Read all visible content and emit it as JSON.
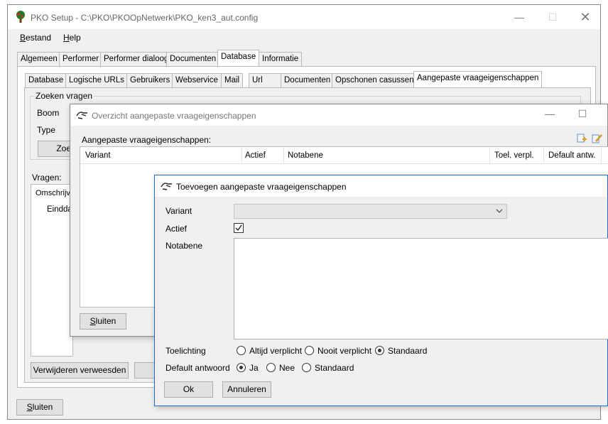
{
  "main_window": {
    "title": "PKO Setup - C:\\PKO\\PKOOpNetwerk\\PKO_ken3_aut.config",
    "menu": [
      {
        "first": "B",
        "rest": "estand"
      },
      {
        "first": "H",
        "rest": "elp"
      }
    ],
    "tabs": [
      "Algemeen",
      "Performer",
      "Performer dialoog",
      "Documenten",
      "Database",
      "Informatie"
    ],
    "active_tab": "Database",
    "subtabs": [
      "Database",
      "Logische URLs",
      "Gebruikers",
      "Webservice",
      "Mail",
      "Url",
      "Documenten",
      "Opschonen casussen",
      "Aangepaste vraageigenschappen"
    ],
    "active_subtab": "Aangepaste vraageigenschappen",
    "group_title": "Zoeken vragen",
    "boom_label": "Boom",
    "type_label": "Type",
    "zoek_button": "Zoek",
    "vragen_label": "Vragen:",
    "omschrijving_label": "Omschrijvi",
    "einddatum_label": "Eindda",
    "verwijderen_button": "Verwijderen verweesden",
    "sluiten_button": {
      "first": "S",
      "rest": "luiten"
    }
  },
  "overview_dialog": {
    "title": "Overzicht aangepaste vraageigenschappen",
    "list_label": "Aangepaste vraageigenschappen:",
    "columns": [
      "Variant",
      "Actief",
      "Notabene",
      "Toel. verpl.",
      "Default antw."
    ],
    "sluiten_button": {
      "first": "S",
      "rest": "luiten"
    }
  },
  "add_dialog": {
    "title": "Toevoegen aangepaste vraageigenschappen",
    "variant_label": "Variant",
    "variant_value": "",
    "actief_label": "Actief",
    "actief_checked": true,
    "notabene_label": "Notabene",
    "notabene_value": "",
    "toelichting_label": "Toelichting",
    "toelichting_options": [
      "Altijd verplicht",
      "Nooit verplicht",
      "Standaard"
    ],
    "toelichting_selected": "Standaard",
    "default_label": "Default antwoord",
    "default_options": [
      "Ja",
      "Nee",
      "Standaard"
    ],
    "default_selected": "Ja",
    "ok_button": "Ok",
    "annuleren_button": "Annuleren"
  }
}
